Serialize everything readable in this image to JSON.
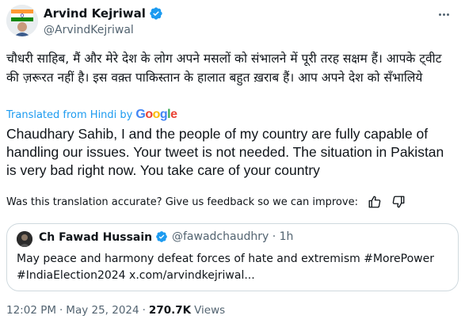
{
  "author": {
    "display_name": "Arvind Kejriwal",
    "handle": "@ArvindKejriwal"
  },
  "tweet": {
    "original_text": "चौधरी साहिब, मैं और मेरे देश के लोग अपने मसलों को संभालने में पूरी तरह सक्षम हैं। आपके ट्वीट की ज़रूरत नहीं है। इस वक़्त पाकिस्तान के हालात बहुत ख़राब हैं। आप अपने देश को सँभालिये",
    "translated_label": "Translated from Hindi by",
    "translation": "Chaudhary Sahib, I and the people of my country are fully capable of handling our issues. Your tweet is not needed. The situation in Pakistan is very bad right now. You take care of your country",
    "feedback_prompt": "Was this translation accurate? Give us feedback so we can improve:"
  },
  "google": {
    "letters": [
      "G",
      "o",
      "o",
      "g",
      "l",
      "e"
    ],
    "colors": [
      "#4285F4",
      "#EA4335",
      "#FBBC05",
      "#4285F4",
      "#34A853",
      "#EA4335"
    ]
  },
  "quoted": {
    "display_name": "Ch Fawad Hussain",
    "handle_time": "@fawadchaudhry · 1h",
    "text": "May peace and harmony defeat forces of hate and extremism #MorePower #IndiaElection2024 x.com/arvindkejriwal..."
  },
  "meta": {
    "time": "12:02 PM",
    "date": "May 25, 2024",
    "views_count": "270.7K",
    "views_label": "Views"
  },
  "colors": {
    "verified": "#1d9bf0",
    "accent": "#1d9bf0",
    "secondary_text": "#536471",
    "border": "#cfd9de"
  }
}
